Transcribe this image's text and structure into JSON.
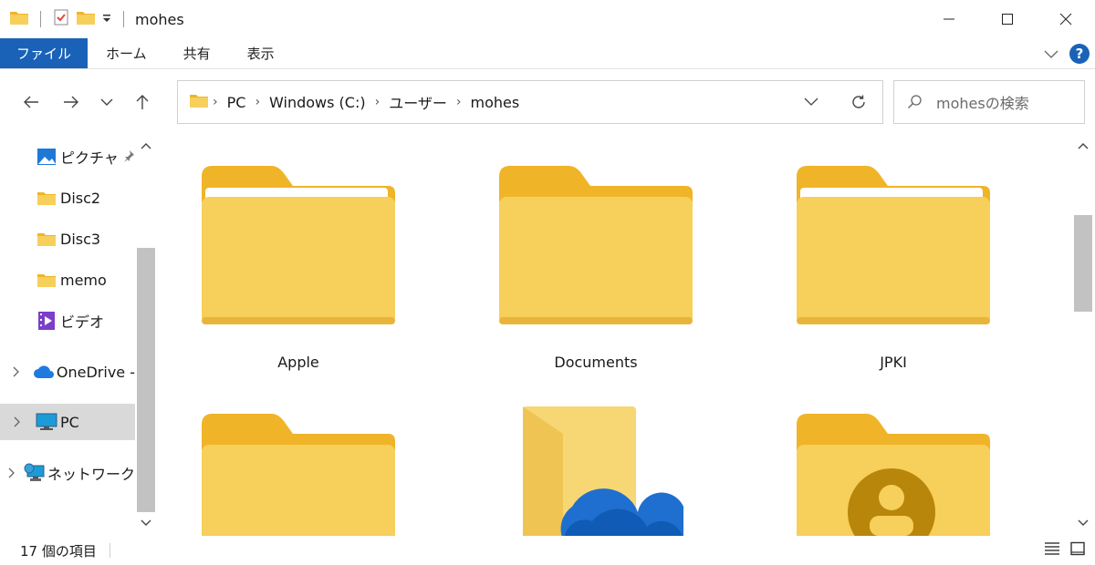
{
  "window": {
    "title": "mohes"
  },
  "ribbon": {
    "tabs": [
      "ファイル",
      "ホーム",
      "共有",
      "表示"
    ],
    "help": "?"
  },
  "address": {
    "crumbs": [
      "PC",
      "Windows (C:)",
      "ユーザー",
      "mohes"
    ]
  },
  "search": {
    "placeholder": "mohesの検索"
  },
  "sidebar": {
    "items": [
      {
        "label": "ピクチャ",
        "icon": "pictures-icon"
      },
      {
        "label": "Disc2",
        "icon": "folder-icon"
      },
      {
        "label": "Disc3",
        "icon": "folder-icon"
      },
      {
        "label": "memo",
        "icon": "folder-icon"
      },
      {
        "label": "ビデオ",
        "icon": "videos-icon"
      },
      {
        "label": "OneDrive -",
        "icon": "onedrive-icon"
      },
      {
        "label": "PC",
        "icon": "pc-icon"
      },
      {
        "label": "ネットワーク",
        "icon": "network-icon"
      }
    ]
  },
  "content": {
    "folders": [
      {
        "label": "Apple"
      },
      {
        "label": "Documents"
      },
      {
        "label": "JPKI"
      },
      {
        "label": ""
      },
      {
        "label": ""
      },
      {
        "label": ""
      }
    ]
  },
  "status": {
    "item_count": "17 個の項目"
  },
  "colors": {
    "accent": "#1a62b8",
    "folder": "#f7cf5b",
    "folder_tab": "#f0b429",
    "selected": "#d9d9d9"
  }
}
